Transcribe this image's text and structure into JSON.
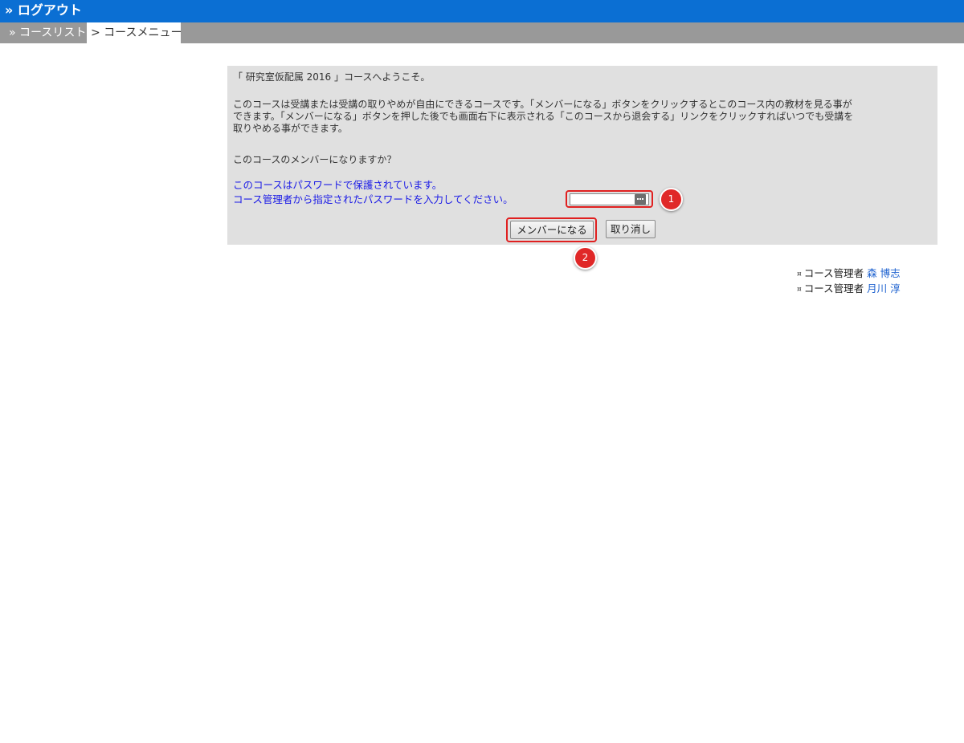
{
  "topbar": {
    "logout_label": "» ログアウト"
  },
  "breadcrumb": {
    "course_list": "» コースリスト",
    "current": "> コースメニュー"
  },
  "panel": {
    "welcome": "「 研究室仮配属 2016 」コースへようこそ。",
    "description_lines": [
      "このコースは受講または受講の取りやめが自由にできるコースです。「メンバーになる」ボタンをクリックするとこのコース内の教材を見る事が",
      "できます。「メンバーになる」ボタンを押した後でも画面右下に表示される「このコースから退会する」リンクをクリックすればいつでも受講を",
      "取りやめる事ができます。"
    ],
    "question": "このコースのメンバーになりますか？",
    "protected_notice": "このコースはパスワードで保護されています。",
    "password_prompt": "コース管理者から指定されたパスワードを入力してください。",
    "password_value": "",
    "password_placeholder": "",
    "join_button": "メンバーになる",
    "cancel_button": "取り消し"
  },
  "markers": {
    "first": "1",
    "second": "2"
  },
  "managers": [
    {
      "role": "コース管理者",
      "name": "森 博志"
    },
    {
      "role": "コース管理者",
      "name": "月川 淳"
    }
  ],
  "icons": {
    "bullet": "¤",
    "password_field_icon": "key-icon"
  },
  "colors": {
    "topbar": "#0b6fd3",
    "breadcrumb_bar": "#999999",
    "panel_bg": "#e0e0e0",
    "notice_text": "#1a1ae6",
    "link": "#1a5fcf",
    "highlight": "#e02020"
  }
}
